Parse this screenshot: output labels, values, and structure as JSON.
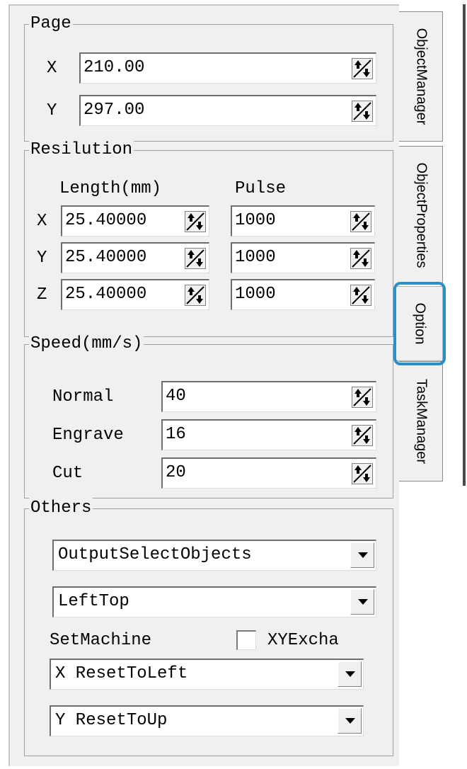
{
  "page": {
    "title": "Page",
    "x_label": "X",
    "x_value": "210.00",
    "y_label": "Y",
    "y_value": "297.00"
  },
  "resolution": {
    "title": "Resilution",
    "col_length": "Length(mm)",
    "col_pulse": "Pulse",
    "rows": [
      {
        "axis": "X",
        "length": "25.40000",
        "pulse": "1000"
      },
      {
        "axis": "Y",
        "length": "25.40000",
        "pulse": "1000"
      },
      {
        "axis": "Z",
        "length": "25.40000",
        "pulse": "1000"
      }
    ]
  },
  "speed": {
    "title": "Speed(mm/s)",
    "rows": [
      {
        "label": "Normal",
        "value": "40"
      },
      {
        "label": "Engrave",
        "value": "16"
      },
      {
        "label": "Cut",
        "value": "20"
      }
    ]
  },
  "others": {
    "title": "Others",
    "output_select": "OutputSelectObjects",
    "origin_select": "LeftTop",
    "set_machine_label": "SetMachine",
    "xy_exchange_label": "XYExcha",
    "xy_exchange_checked": false,
    "x_reset_select": "X ResetToLeft",
    "y_reset_select": "Y ResetToUp"
  },
  "tabs": [
    {
      "label": "ObjectManager",
      "active": false
    },
    {
      "label": "ObjectProperties",
      "active": false
    },
    {
      "label": "Option",
      "active": true
    },
    {
      "label": "TaskManager",
      "active": false
    }
  ],
  "highlight_color": "#2e8fc4",
  "icons": {
    "spin": "spin-arrows-icon",
    "dropdown": "chevron-down-icon"
  }
}
